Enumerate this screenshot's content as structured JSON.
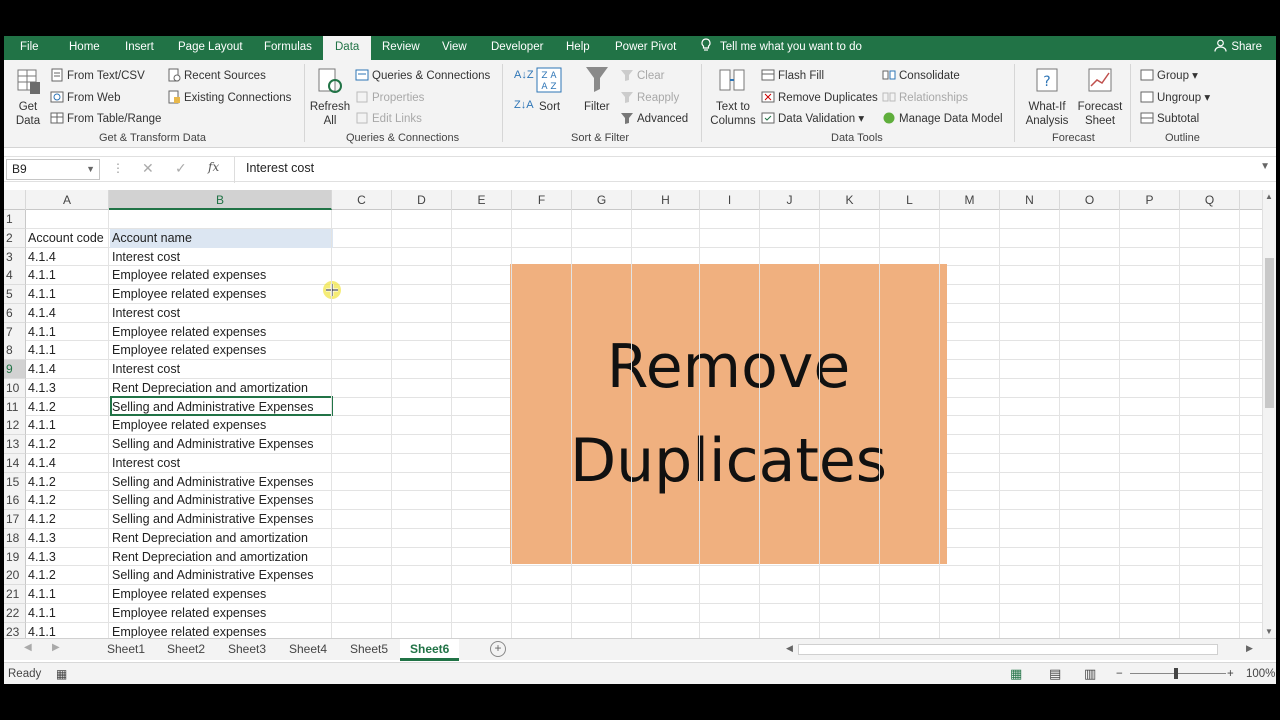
{
  "ribbon_tabs": [
    "File",
    "Home",
    "Insert",
    "Page Layout",
    "Formulas",
    "Data",
    "Review",
    "View",
    "Developer",
    "Help",
    "Power Pivot"
  ],
  "active_tab": "Data",
  "tell_me": "Tell me what you want to do",
  "share": "Share",
  "groups": {
    "get_transform": {
      "label": "Get & Transform Data",
      "get_data": "Get Data",
      "items": [
        "From Text/CSV",
        "From Web",
        "From Table/Range",
        "Recent Sources",
        "Existing Connections"
      ]
    },
    "queries": {
      "label": "Queries & Connections",
      "refresh_all": "Refresh All",
      "items": [
        "Queries & Connections",
        "Properties",
        "Edit Links"
      ]
    },
    "sort_filter": {
      "label": "Sort & Filter",
      "sort": "Sort",
      "filter": "Filter",
      "items": [
        "Clear",
        "Reapply",
        "Advanced"
      ]
    },
    "data_tools": {
      "label": "Data Tools",
      "text_to_columns": "Text to Columns",
      "items": [
        "Flash Fill",
        "Remove Duplicates",
        "Data Validation",
        "Consolidate",
        "Relationships",
        "Manage Data Model"
      ]
    },
    "forecast": {
      "label": "Forecast",
      "what_if": "What-If Analysis",
      "forecast_sheet": "Forecast Sheet"
    },
    "outline": {
      "label": "Outline",
      "items": [
        "Group",
        "Ungroup",
        "Subtotal"
      ]
    }
  },
  "name_box": "B9",
  "formula": "Interest cost",
  "columns": [
    "A",
    "B",
    "C",
    "D",
    "E",
    "F",
    "G",
    "H",
    "I",
    "J",
    "K",
    "L",
    "M",
    "N",
    "O",
    "P",
    "Q"
  ],
  "headers": {
    "code": "Account code",
    "name": "Account name"
  },
  "rows": [
    {
      "n": "1",
      "code": "",
      "name": ""
    },
    {
      "n": "2",
      "code": "Account code",
      "name": "Account name"
    },
    {
      "n": "3",
      "code": "4.1.4",
      "name": "Interest cost"
    },
    {
      "n": "4",
      "code": "4.1.1",
      "name": "Employee related expenses"
    },
    {
      "n": "5",
      "code": "4.1.1",
      "name": "Employee related expenses"
    },
    {
      "n": "6",
      "code": "4.1.4",
      "name": "Interest cost"
    },
    {
      "n": "7",
      "code": "4.1.1",
      "name": "Employee related expenses"
    },
    {
      "n": "8",
      "code": "4.1.1",
      "name": "Employee related expenses"
    },
    {
      "n": "9",
      "code": "4.1.4",
      "name": "Interest cost"
    },
    {
      "n": "10",
      "code": "4.1.3",
      "name": "Rent Depreciation and amortization"
    },
    {
      "n": "11",
      "code": "4.1.2",
      "name": "Selling and Administrative Expenses"
    },
    {
      "n": "12",
      "code": "4.1.1",
      "name": "Employee related expenses"
    },
    {
      "n": "13",
      "code": "4.1.2",
      "name": "Selling and Administrative Expenses"
    },
    {
      "n": "14",
      "code": "4.1.4",
      "name": "Interest cost"
    },
    {
      "n": "15",
      "code": "4.1.2",
      "name": "Selling and Administrative Expenses"
    },
    {
      "n": "16",
      "code": "4.1.2",
      "name": "Selling and Administrative Expenses"
    },
    {
      "n": "17",
      "code": "4.1.2",
      "name": "Selling and Administrative Expenses"
    },
    {
      "n": "18",
      "code": "4.1.3",
      "name": "Rent Depreciation and amortization"
    },
    {
      "n": "19",
      "code": "4.1.3",
      "name": "Rent Depreciation and amortization"
    },
    {
      "n": "20",
      "code": "4.1.2",
      "name": "Selling and Administrative Expenses"
    },
    {
      "n": "21",
      "code": "4.1.1",
      "name": "Employee related expenses"
    },
    {
      "n": "22",
      "code": "4.1.1",
      "name": "Employee related expenses"
    },
    {
      "n": "23",
      "code": "4.1.1",
      "name": "Employee related expenses"
    }
  ],
  "banner": {
    "line1": "Remove",
    "line2": "Duplicates",
    "color": "#f0b07f"
  },
  "sheets": [
    "Sheet1",
    "Sheet2",
    "Sheet3",
    "Sheet4",
    "Sheet5",
    "Sheet6"
  ],
  "active_sheet": "Sheet6",
  "status": "Ready",
  "zoom": "100%",
  "colors": {
    "accent": "#217346",
    "selection": "#217346"
  }
}
